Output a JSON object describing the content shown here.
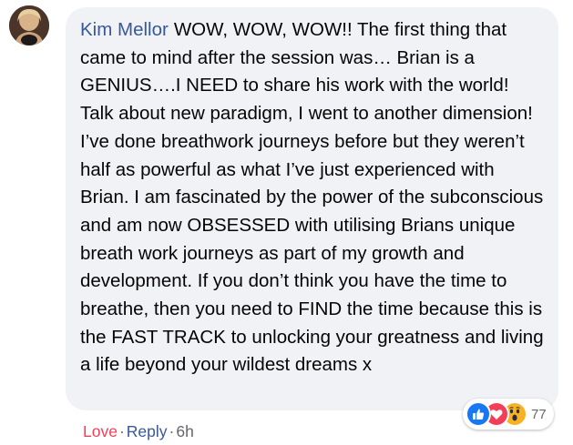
{
  "comment": {
    "author": "Kim Mellor",
    "text": "WOW, WOW, WOW!! The first thing that came to mind after the session was… Brian is a GENIUS….I NEED to share his work with the world! Talk about new paradigm, I went to another dimension! I’ve done breathwork journeys before but they weren’t half as powerful as what I’ve just experienced with Brian. I am fascinated by the power of the subconscious and am now OBSESSED with utilising Brians unique breath work journeys as part of my growth and development. If you don’t think you have the time to breathe, then you need to FIND the time because this is the FAST TRACK to unlocking your greatness and living a life beyond your wildest dreams x"
  },
  "reactions": {
    "icons": [
      "like-icon",
      "love-icon",
      "wow-icon"
    ],
    "count": "77"
  },
  "actions": {
    "love_label": "Love",
    "reply_label": "Reply",
    "separator": "·",
    "timestamp": "6h"
  },
  "colors": {
    "bubble_bg": "#f0f2f5",
    "author": "#385898",
    "love": "#f33e58",
    "like": "#1877f2",
    "wow": "#f7b125",
    "meta": "#65676b"
  }
}
